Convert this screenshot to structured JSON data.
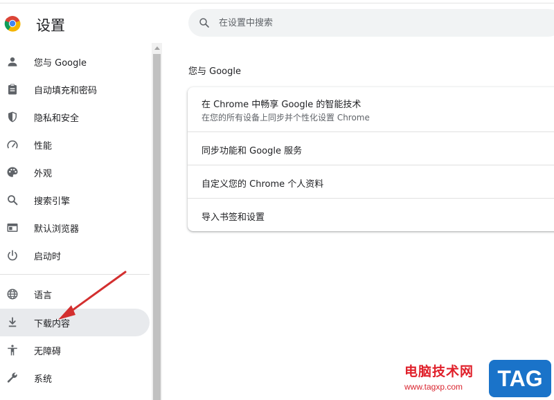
{
  "header": {
    "title": "设置"
  },
  "search": {
    "placeholder": "在设置中搜索"
  },
  "sidebar": {
    "items": [
      {
        "label": "您与 Google",
        "icon": "person-icon"
      },
      {
        "label": "自动填充和密码",
        "icon": "clipboard-icon"
      },
      {
        "label": "隐私和安全",
        "icon": "shield-icon"
      },
      {
        "label": "性能",
        "icon": "speedometer-icon"
      },
      {
        "label": "外观",
        "icon": "palette-icon"
      },
      {
        "label": "搜索引擎",
        "icon": "search-icon"
      },
      {
        "label": "默认浏览器",
        "icon": "browser-icon"
      },
      {
        "label": "启动时",
        "icon": "power-icon"
      },
      {
        "label": "语言",
        "icon": "globe-icon"
      },
      {
        "label": "下载内容",
        "icon": "download-icon",
        "active": true
      },
      {
        "label": "无障碍",
        "icon": "accessibility-icon"
      },
      {
        "label": "系统",
        "icon": "wrench-icon"
      }
    ]
  },
  "main": {
    "section_title": "您与 Google",
    "rows": [
      {
        "title": "在 Chrome 中畅享 Google 的智能技术",
        "subtitle": "在您的所有设备上同步并个性化设置 Chrome"
      },
      {
        "title": "同步功能和 Google 服务"
      },
      {
        "title": "自定义您的 Chrome 个人资料"
      },
      {
        "title": "导入书签和设置"
      }
    ]
  },
  "watermark": {
    "site_name": "电脑技术网",
    "url": "www.tagxp.com",
    "badge": "TAG"
  },
  "colors": {
    "accent": "#1a73e8",
    "active_bg": "#e8eaed",
    "icon": "#5f6368",
    "annotation_arrow": "#d32f2f",
    "watermark_red": "#e0202a",
    "watermark_blue": "#1a73c9"
  }
}
